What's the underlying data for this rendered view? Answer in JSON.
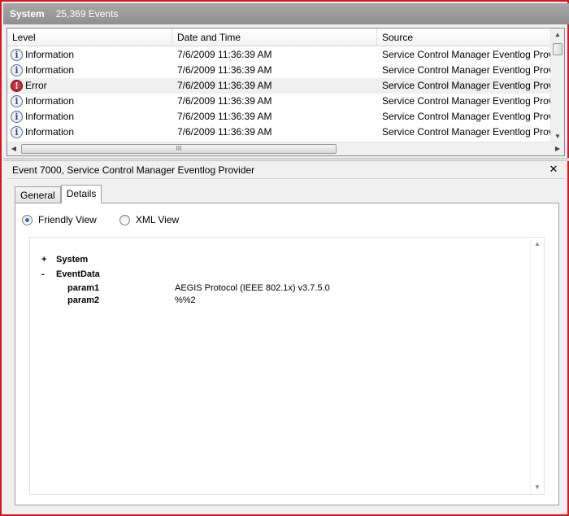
{
  "header": {
    "title": "System",
    "count": "25,369 Events"
  },
  "grid": {
    "columns": [
      "Level",
      "Date and Time",
      "Source"
    ],
    "rows": [
      {
        "level": "Information",
        "icon": "info-icon",
        "date": "7/6/2009 11:36:39 AM",
        "source": "Service Control Manager Eventlog Prov"
      },
      {
        "level": "Information",
        "icon": "info-icon",
        "date": "7/6/2009 11:36:39 AM",
        "source": "Service Control Manager Eventlog Prov"
      },
      {
        "level": "Error",
        "icon": "error-icon",
        "date": "7/6/2009 11:36:39 AM",
        "source": "Service Control Manager Eventlog Prov"
      },
      {
        "level": "Information",
        "icon": "info-icon",
        "date": "7/6/2009 11:36:39 AM",
        "source": "Service Control Manager Eventlog Prov"
      },
      {
        "level": "Information",
        "icon": "info-icon",
        "date": "7/6/2009 11:36:39 AM",
        "source": "Service Control Manager Eventlog Prov"
      },
      {
        "level": "Information",
        "icon": "info-icon",
        "date": "7/6/2009 11:36:39 AM",
        "source": "Service Control Manager Eventlog Prov"
      }
    ],
    "hscroll_grip": "III"
  },
  "event": {
    "title": "Event 7000, Service Control Manager Eventlog Provider",
    "close_glyph": "✕"
  },
  "tabs": [
    {
      "label": "General",
      "active": false
    },
    {
      "label": "Details",
      "active": true
    }
  ],
  "view_options": {
    "friendly": "Friendly View",
    "xml": "XML View",
    "selected": "Friendly View"
  },
  "details": {
    "system": {
      "sign": "+",
      "label": "System"
    },
    "eventdata": {
      "sign": "-",
      "label": "EventData"
    },
    "params": [
      {
        "name": "param1",
        "value": "AEGIS Protocol (IEEE 802.1x) v3.7.5.0"
      },
      {
        "name": "param2",
        "value": "%%2"
      }
    ]
  },
  "colors": {
    "frame_border": "#d8161d",
    "header_bg": "#999999",
    "error_icon": "#b01020",
    "info_icon": "#2c4a78"
  }
}
